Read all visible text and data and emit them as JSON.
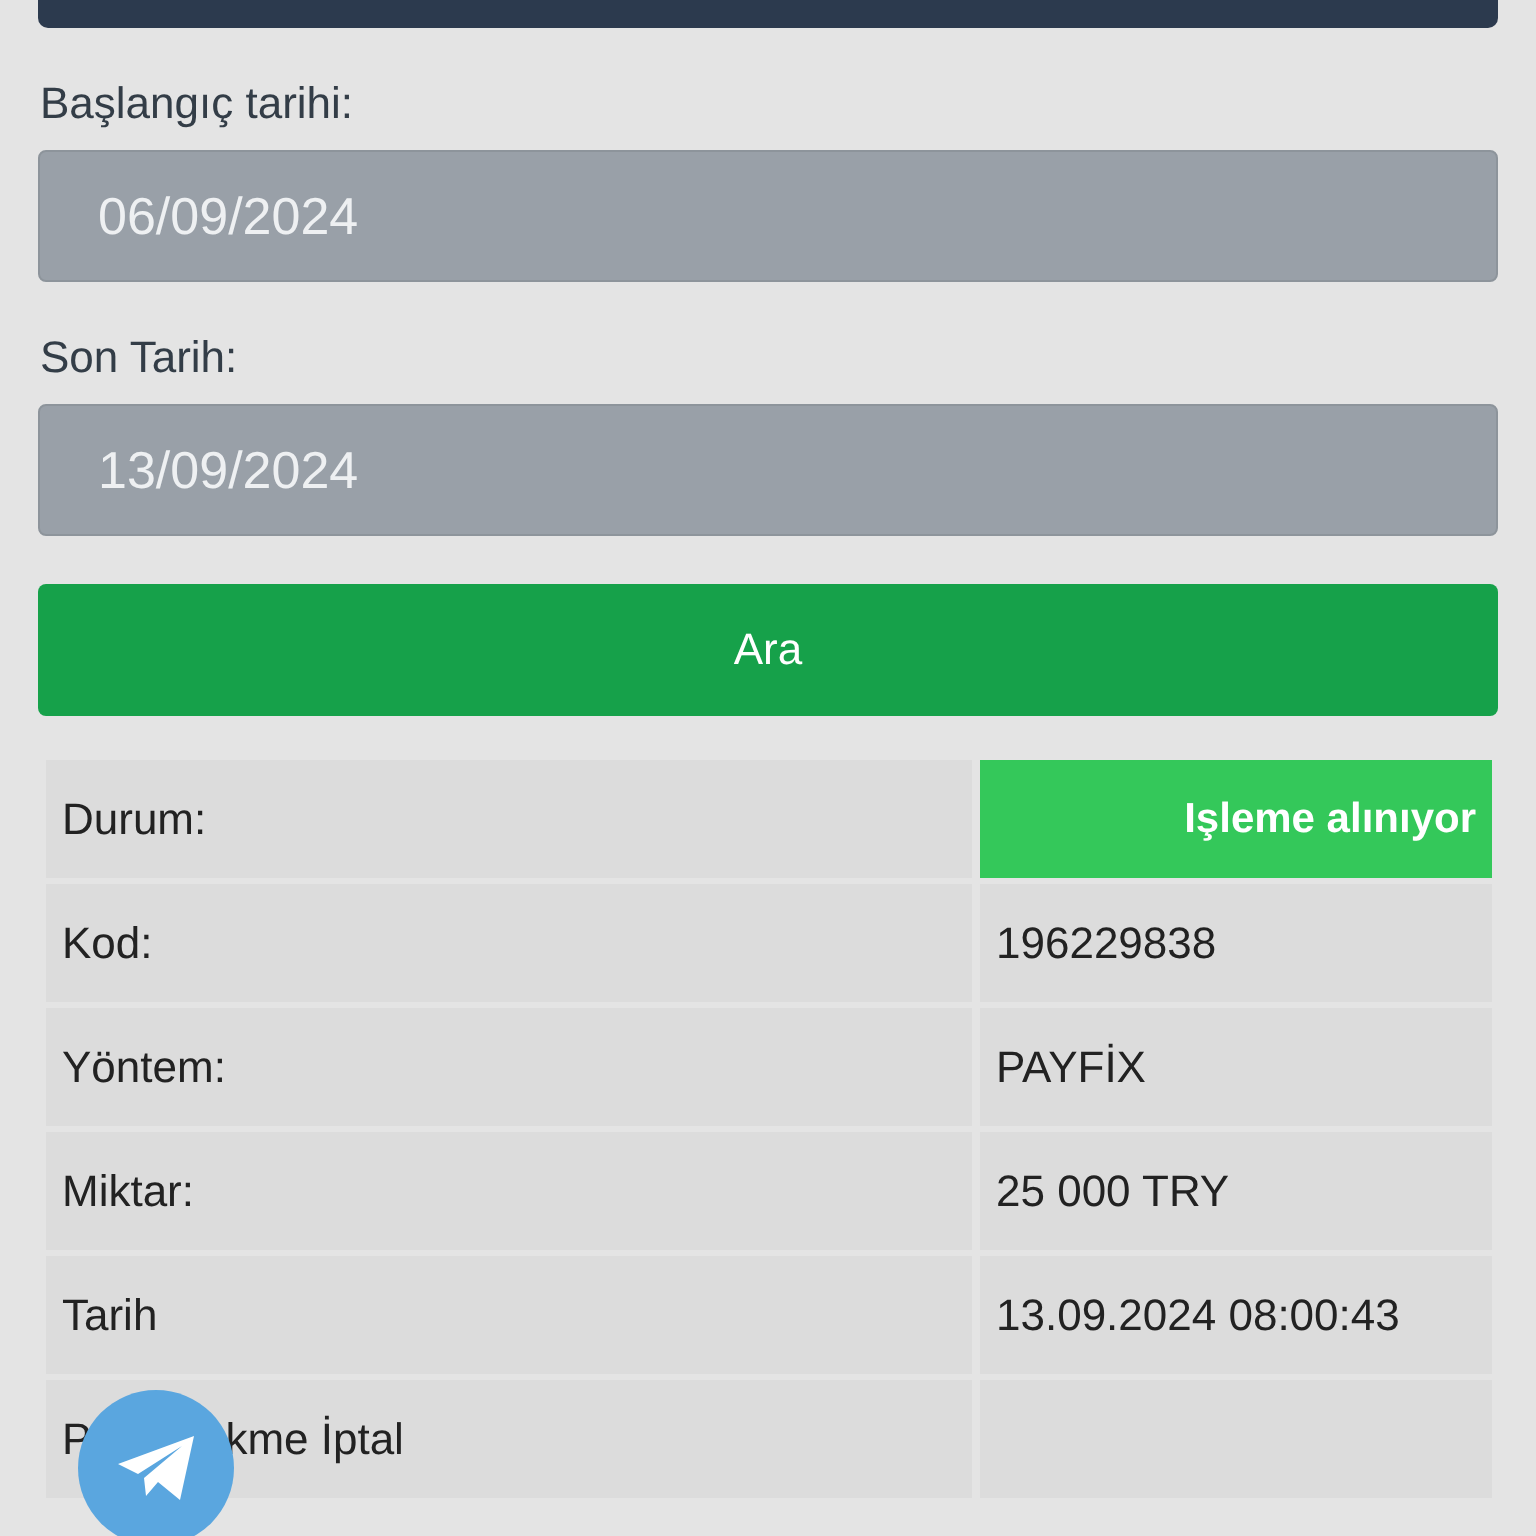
{
  "filters": [
    {
      "label": "Başlangıç tarihi:",
      "value": "06/09/2024"
    },
    {
      "label": "Son Tarih:",
      "value": "13/09/2024"
    }
  ],
  "search_button": "Ara",
  "details": [
    {
      "kind": "status",
      "label": "Durum:",
      "value": "Işleme alınıyor",
      "color": "#34c85a"
    },
    {
      "kind": "text",
      "label": "Kod:",
      "value": "196229838"
    },
    {
      "kind": "text",
      "label": "Yöntem:",
      "value": "PAYFİX"
    },
    {
      "kind": "text",
      "label": "Miktar:",
      "value": "25 000 TRY"
    },
    {
      "kind": "text",
      "label": "Tarih",
      "value": "13.09.2024 08:00:43"
    },
    {
      "kind": "covered",
      "label_parts": [
        "P",
        "kme İptal"
      ]
    }
  ]
}
